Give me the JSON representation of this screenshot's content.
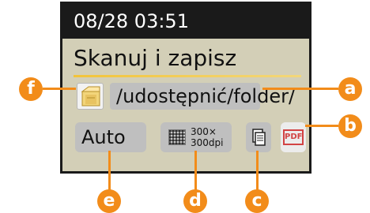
{
  "panel": {
    "time": "08/28 03:51",
    "title": "Skanuj i zapisz",
    "path": "/udostępnić/folder/",
    "auto_label": "Auto",
    "resolution_label": "300×\n300dpi",
    "pdf_label": "PDF"
  },
  "callouts": {
    "a": "a",
    "b": "b",
    "c": "c",
    "d": "d",
    "e": "e",
    "f": "f"
  },
  "colors": {
    "callout": "#f28c1a",
    "panel_bg": "#d3cfb7",
    "topbar_bg": "#1a1a1a"
  }
}
